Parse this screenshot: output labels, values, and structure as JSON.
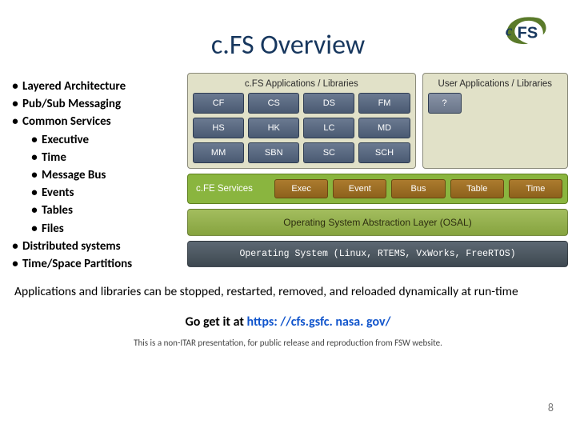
{
  "title": "c.FS Overview",
  "bullets": {
    "items": [
      "Layered Architecture",
      "Pub/Sub Messaging",
      "Common Services",
      "Distributed systems",
      "Time/Space Partitions"
    ],
    "sub": [
      "Executive",
      "Time",
      "Message Bus",
      "Events",
      "Tables",
      "Files"
    ]
  },
  "diagram": {
    "apps_left_title": "c.FS Applications / Libraries",
    "apps_right_title": "User Applications / Libraries",
    "apps": [
      "CF",
      "CS",
      "DS",
      "FM",
      "HS",
      "HK",
      "LC",
      "MD",
      "MM",
      "SBN",
      "SC",
      "SCH"
    ],
    "user_app": "?",
    "cfe_label": "c.FE Services",
    "cfe_services": [
      "Exec",
      "Event",
      "Bus",
      "Table",
      "Time"
    ],
    "osal": "Operating System Abstraction Layer (OSAL)",
    "os": "Operating System (Linux, RTEMS, VxWorks, FreeRTOS)"
  },
  "note": "Applications and libraries can be stopped, restarted, removed, and reloaded dynamically at run-time",
  "cta_prefix": "Go get it at  ",
  "cta_url": "https: //cfs.gsfc. nasa. gov/",
  "disclaimer": "This is a non-ITAR presentation, for public release and reproduction from FSW website.",
  "page": "8"
}
